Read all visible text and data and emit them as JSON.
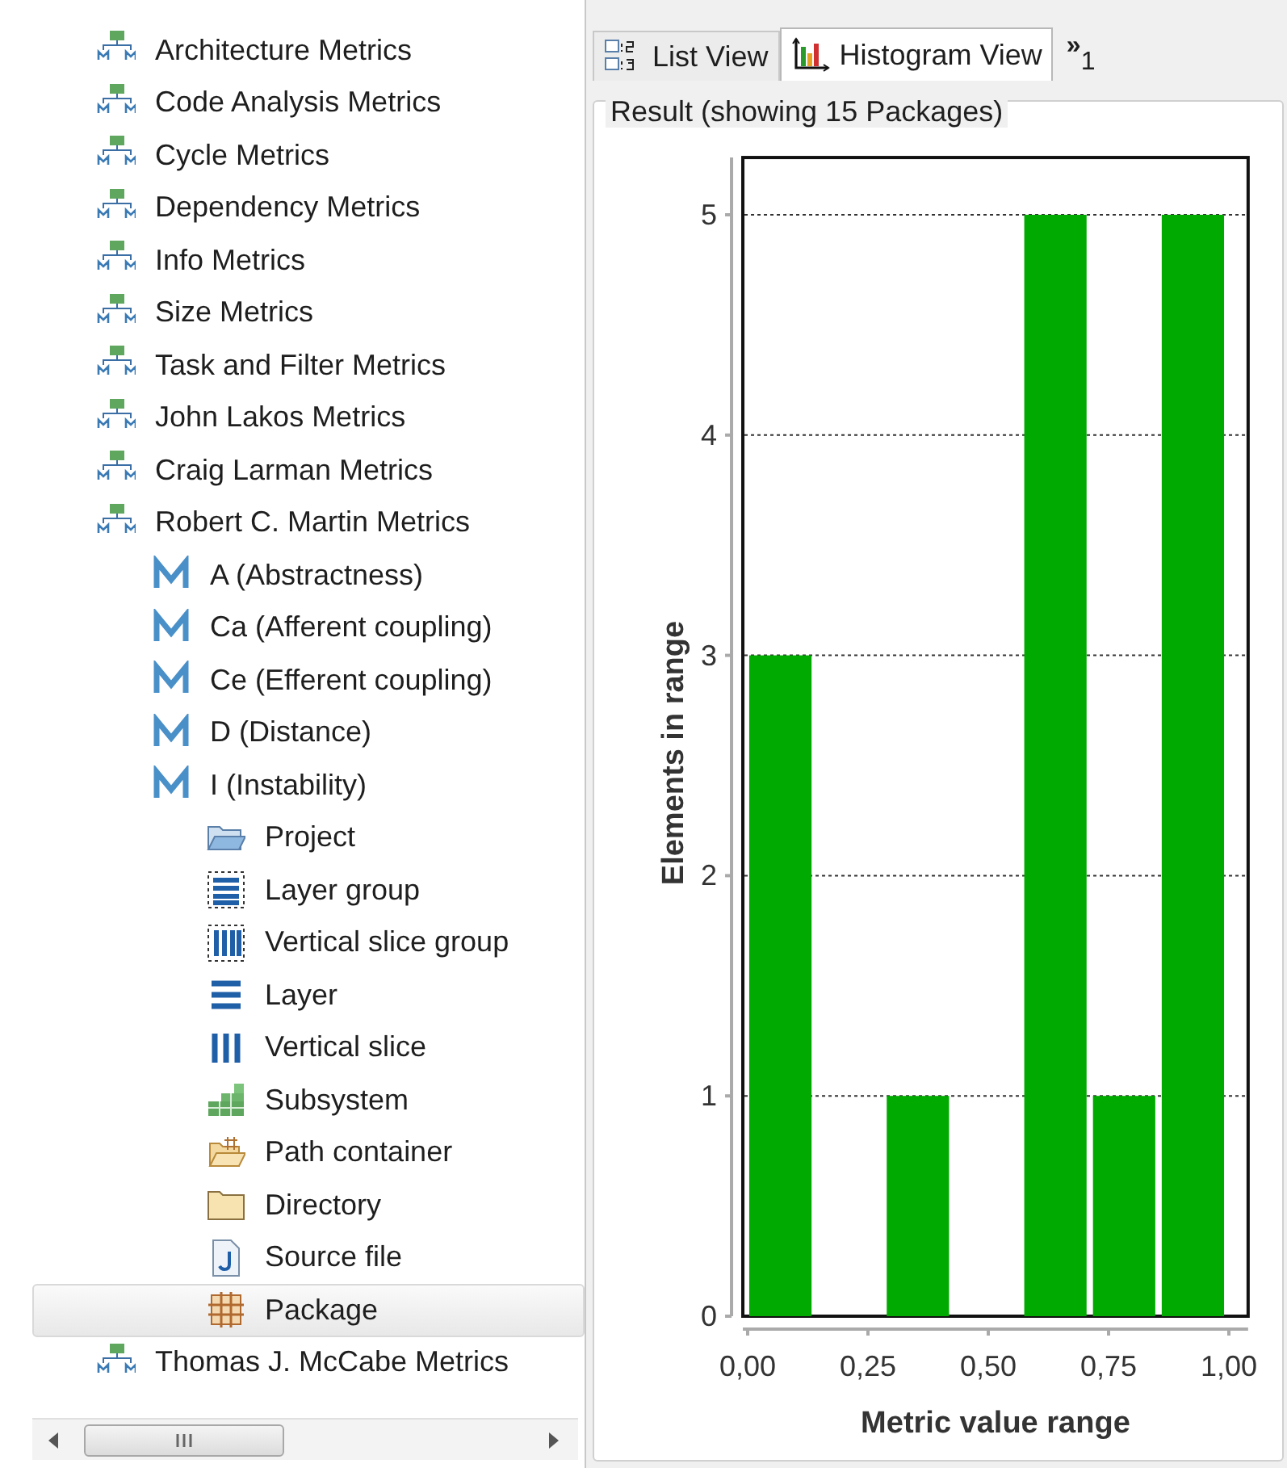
{
  "tree": [
    {
      "label": "Architecture Metrics",
      "kind": "metric_set",
      "selected": false
    },
    {
      "label": "Code Analysis Metrics",
      "kind": "metric_set",
      "selected": false
    },
    {
      "label": "Cycle Metrics",
      "kind": "metric_set",
      "selected": false
    },
    {
      "label": "Dependency Metrics",
      "kind": "metric_set",
      "selected": false
    },
    {
      "label": "Info Metrics",
      "kind": "metric_set",
      "selected": false
    },
    {
      "label": "Size Metrics",
      "kind": "metric_set",
      "selected": false
    },
    {
      "label": "Task and Filter Metrics",
      "kind": "metric_set",
      "selected": false
    },
    {
      "label": "John Lakos Metrics",
      "kind": "metric_set",
      "selected": false
    },
    {
      "label": "Craig Larman Metrics",
      "kind": "metric_set",
      "selected": false
    },
    {
      "label": "Robert C. Martin Metrics",
      "kind": "metric_set",
      "selected": false,
      "children": [
        {
          "label": "A (Abstractness)",
          "kind": "metric",
          "selected": false
        },
        {
          "label": "Ca (Afferent coupling)",
          "kind": "metric",
          "selected": false
        },
        {
          "label": "Ce (Efferent coupling)",
          "kind": "metric",
          "selected": false
        },
        {
          "label": "D (Distance)",
          "kind": "metric",
          "selected": false
        },
        {
          "label": "I (Instability)",
          "kind": "metric",
          "selected": false,
          "children": [
            {
              "label": "Project",
              "kind": "project",
              "selected": false
            },
            {
              "label": "Layer group",
              "kind": "layer_group",
              "selected": false
            },
            {
              "label": "Vertical slice group",
              "kind": "slice_group",
              "selected": false
            },
            {
              "label": "Layer",
              "kind": "layer",
              "selected": false
            },
            {
              "label": "Vertical slice",
              "kind": "slice",
              "selected": false
            },
            {
              "label": "Subsystem",
              "kind": "subsystem",
              "selected": false
            },
            {
              "label": "Path container",
              "kind": "path_container",
              "selected": false
            },
            {
              "label": "Directory",
              "kind": "directory",
              "selected": false
            },
            {
              "label": "Source file",
              "kind": "source_file",
              "selected": false
            },
            {
              "label": "Package",
              "kind": "package",
              "selected": true
            }
          ]
        }
      ]
    },
    {
      "label": "Thomas J. McCabe Metrics",
      "kind": "metric_set",
      "selected": false
    }
  ],
  "tabs": [
    {
      "label": "List View",
      "kind": "list",
      "selected": false
    },
    {
      "label": "Histogram View",
      "kind": "histogram",
      "selected": true
    }
  ],
  "tab_overflow": {
    "chevron": "»",
    "count": "1"
  },
  "result": {
    "title": "Result (showing 15 Packages)",
    "chart_data": {
      "type": "bar",
      "xlabel": "Metric value range",
      "ylabel": "Elements in range",
      "x": [
        0.0714,
        0.2143,
        0.3571,
        0.5,
        0.6429,
        0.7857,
        0.9286
      ],
      "series": [
        {
          "color": "#00aa00",
          "values": [
            3,
            0,
            1,
            0,
            5,
            1,
            5
          ]
        }
      ],
      "grid": true,
      "xlim": [
        -0.01,
        1.04
      ],
      "ylim": [
        0,
        5.26
      ],
      "xticks": [
        {
          "value": 0,
          "label": "0,00"
        },
        {
          "value": 0.25,
          "label": "0,25"
        },
        {
          "value": 0.5,
          "label": "0,50"
        },
        {
          "value": 0.75,
          "label": "0,75"
        },
        {
          "value": 1,
          "label": "1,00"
        }
      ],
      "yticks": [
        0,
        1,
        2,
        3,
        4,
        5
      ]
    }
  }
}
